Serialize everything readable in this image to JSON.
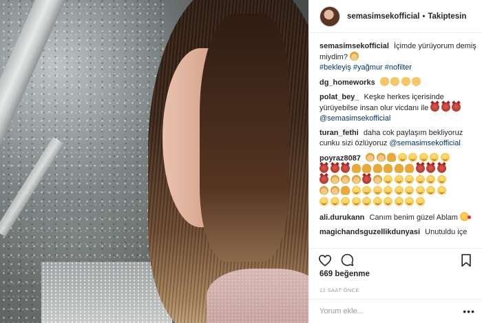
{
  "header": {
    "username": "semasimsekofficial",
    "separator": "•",
    "follow_status": "Takiptesin"
  },
  "comments": [
    {
      "user": "semasimsekofficial",
      "text": "İçimde yürüyorum demiş miydim?",
      "emoji": [
        "woman-walking"
      ],
      "hashtags": [
        "#bekleyiş",
        "#yağmur",
        "#nofilter"
      ]
    },
    {
      "user": "dg_homeworks",
      "text": "",
      "emoji": [
        "thumbs-up",
        "thumbs-up",
        "thumbs-up",
        "thumbs-up"
      ]
    },
    {
      "user": "polat_bey_",
      "text": "Keşke herkes içerisinde yürüyebilse insan olur vicdanı ile",
      "emoji": [
        "devil",
        "devil",
        "devil"
      ],
      "mention": "@semasimsekofficial"
    },
    {
      "user": "turan_fethi",
      "text": "daha cok paylaşım bekliyoruz cunku sizi özlüyoruz",
      "mention": "@semasimsekofficial"
    },
    {
      "user": "poyraz8087",
      "text": "",
      "emoji_rows": [
        [
          "woman",
          "woman",
          "pray",
          "smile",
          "smile",
          "smile",
          "smile",
          "smile"
        ],
        [
          "devil",
          "devil",
          "devil",
          "pray",
          "pray",
          "pray",
          "pray",
          "pray",
          "pray",
          "devil",
          "devil",
          "devil"
        ],
        [
          "devil",
          "woman",
          "woman",
          "woman",
          "devil",
          "woman",
          "smile",
          "smile",
          "smile",
          "smile",
          "smile",
          "smile"
        ],
        [
          "woman",
          "woman",
          "pray",
          "smile",
          "smile",
          "smile",
          "smile",
          "smile",
          "smile",
          "smile",
          "smile",
          "smile"
        ],
        [
          "smile",
          "smile",
          "smile",
          "smile",
          "smile",
          "smile",
          "smile",
          "smile",
          "smile",
          "smile"
        ]
      ]
    },
    {
      "user": "ali.durukann",
      "text": "Canım benim güzel Ablam",
      "emoji": [
        "kiss"
      ]
    },
    {
      "user": "magichandsguzellikdunyasi",
      "text": "Unutuldu içe"
    }
  ],
  "actions": {
    "like_icon": "heart-icon",
    "comment_icon": "comment-icon",
    "save_icon": "bookmark-icon"
  },
  "likes_text": "669 beğenme",
  "time_text": "12 SAAT ÖNCE",
  "add_comment": {
    "placeholder": "Yorum ekle...",
    "more": "•••"
  },
  "colors": {
    "link": "#003569",
    "text": "#262626",
    "muted": "#999999"
  }
}
